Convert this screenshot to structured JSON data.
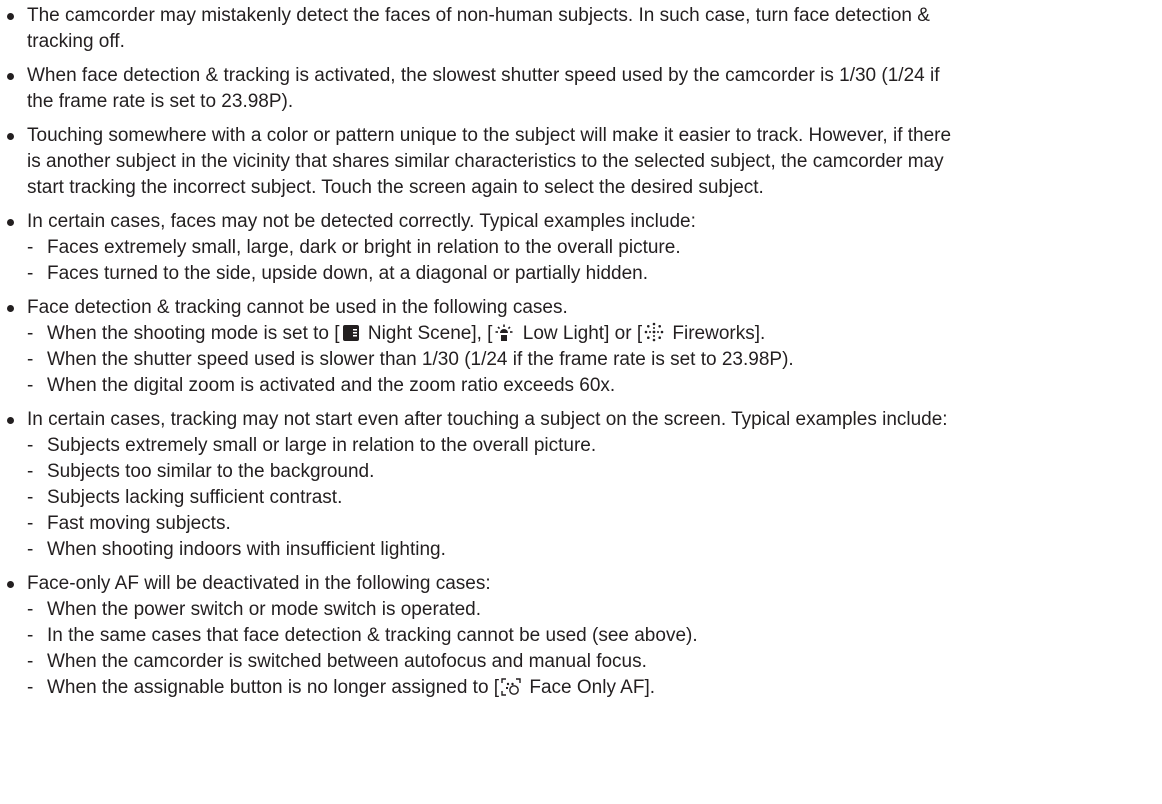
{
  "notes": [
    {
      "lines": [
        "The camcorder may mistakenly detect the faces of non-human subjects. In such case, turn face detection &",
        "tracking off."
      ]
    },
    {
      "lines": [
        "When face detection & tracking is activated, the slowest shutter speed used by the camcorder is 1/30 (1/24 if",
        "the frame rate is set to 23.98P)."
      ]
    },
    {
      "lines": [
        "Touching somewhere with a color or pattern unique to the subject will make it easier to track. However, if there",
        "is another subject in the vicinity that shares similar characteristics to the selected subject, the camcorder may",
        "start tracking the incorrect subject. Touch the screen again to select the desired subject."
      ]
    },
    {
      "lines": [
        "In certain cases, faces may not be detected correctly. Typical examples include:"
      ],
      "subs": [
        "Faces extremely small, large, dark or bright in relation to the overall picture.",
        "Faces turned to the side, upside down, at a diagonal or partially hidden."
      ]
    },
    {
      "lines": [
        "Face detection & tracking cannot be used in the following cases."
      ],
      "mode_line": {
        "prefix": "When the shooting mode is set to [",
        "night": " Night Scene], [",
        "low": " Low Light] or [",
        "fireworks": " Fireworks]."
      },
      "subs": [
        "When the shutter speed used is slower than 1/30 (1/24 if the frame rate is set to 23.98P).",
        "When the digital zoom is activated and the zoom ratio exceeds 60x."
      ]
    },
    {
      "lines": [
        "In certain cases, tracking may not start even after touching a subject on the screen. Typical examples include:"
      ],
      "subs": [
        "Subjects extremely small or large in relation to the overall picture.",
        "Subjects too similar to the background.",
        "Subjects lacking sufficient contrast.",
        "Fast moving subjects.",
        "When shooting indoors with insufficient lighting."
      ]
    },
    {
      "lines": [
        "Face-only AF will be deactivated in the following cases:"
      ],
      "subs": [
        "When the power switch or mode switch is operated.",
        "In the same cases that face detection & tracking cannot be used (see above).",
        "When the camcorder is switched between autofocus and manual focus."
      ],
      "assign_line": {
        "prefix": "When the assignable button is no longer assigned to [",
        "suffix": " Face Only AF]."
      }
    }
  ],
  "dash": "-"
}
